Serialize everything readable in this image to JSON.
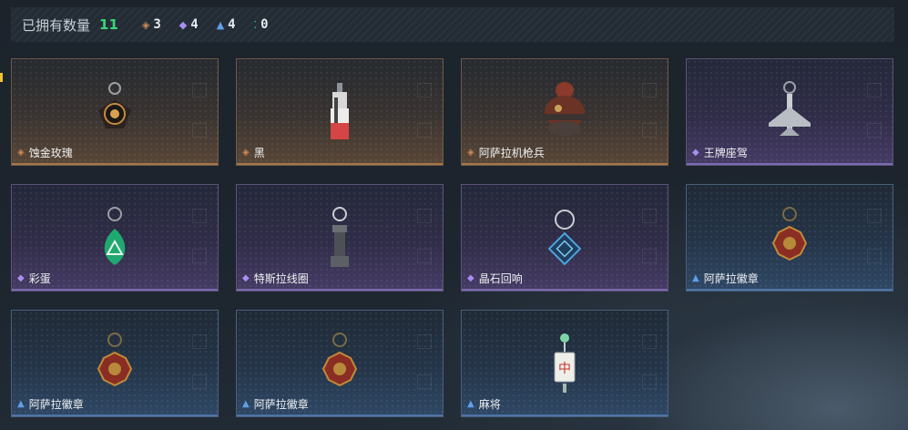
{
  "header": {
    "title": "已拥有数量",
    "count": "11",
    "stats": [
      {
        "icon": "orange-rarity-icon",
        "value": "3",
        "color": "#d08a56"
      },
      {
        "icon": "purple-rarity-icon",
        "value": "4",
        "color": "#a98ef0"
      },
      {
        "icon": "blue-rarity-icon",
        "value": "4",
        "color": "#5f9fe8"
      },
      {
        "icon": "green-rarity-icon",
        "value": "0",
        "color": "#37c7a0"
      }
    ]
  },
  "items": [
    {
      "name": "蚀金玫瑰",
      "rarity": "orange"
    },
    {
      "name": "黑",
      "rarity": "orange"
    },
    {
      "name": "阿萨拉机枪兵",
      "rarity": "orange"
    },
    {
      "name": "王牌座驾",
      "rarity": "purple"
    },
    {
      "name": "彩蛋",
      "rarity": "purple"
    },
    {
      "name": "特斯拉线圈",
      "rarity": "purple"
    },
    {
      "name": "晶石回响",
      "rarity": "purple"
    },
    {
      "name": "阿萨拉徽章",
      "rarity": "blue"
    },
    {
      "name": "阿萨拉徽章",
      "rarity": "blue"
    },
    {
      "name": "阿萨拉徽章",
      "rarity": "blue"
    },
    {
      "name": "麻将",
      "rarity": "blue"
    }
  ]
}
